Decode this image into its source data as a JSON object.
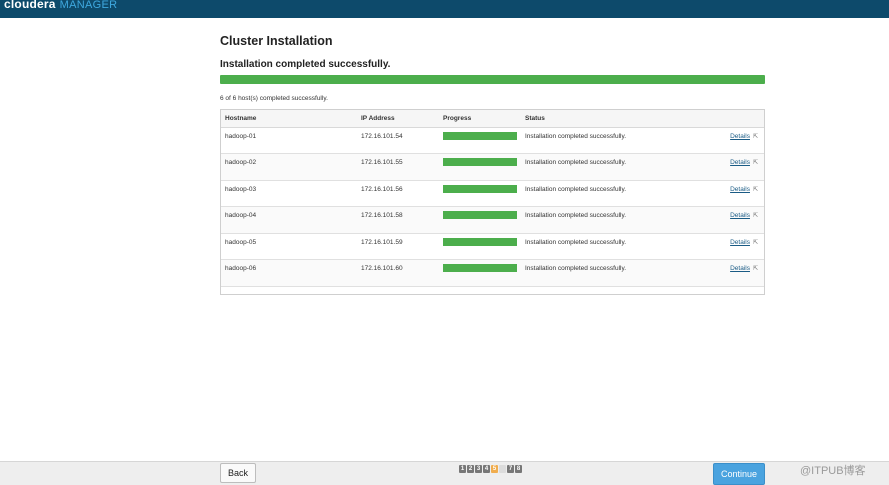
{
  "brand": {
    "name": "cloudera",
    "product": "MANAGER"
  },
  "page": {
    "title": "Cluster Installation",
    "section_title": "Installation completed successfully.",
    "overall_progress_percent": 100,
    "host_summary": "6 of 6 host(s) completed successfully."
  },
  "table": {
    "headers": {
      "hostname": "Hostname",
      "ip": "IP Address",
      "progress": "Progress",
      "status": "Status"
    },
    "rows": [
      {
        "hostname": "hadoop-01",
        "ip": "172.16.101.54",
        "progress_percent": 100,
        "status": "Installation completed successfully.",
        "details": "Details"
      },
      {
        "hostname": "hadoop-02",
        "ip": "172.16.101.55",
        "progress_percent": 100,
        "status": "Installation completed successfully.",
        "details": "Details"
      },
      {
        "hostname": "hadoop-03",
        "ip": "172.16.101.56",
        "progress_percent": 100,
        "status": "Installation completed successfully.",
        "details": "Details"
      },
      {
        "hostname": "hadoop-04",
        "ip": "172.16.101.58",
        "progress_percent": 100,
        "status": "Installation completed successfully.",
        "details": "Details"
      },
      {
        "hostname": "hadoop-05",
        "ip": "172.16.101.59",
        "progress_percent": 100,
        "status": "Installation completed successfully.",
        "details": "Details"
      },
      {
        "hostname": "hadoop-06",
        "ip": "172.16.101.60",
        "progress_percent": 100,
        "status": "Installation completed successfully.",
        "details": "Details"
      }
    ]
  },
  "icons": {
    "details_link": "external-link-icon"
  },
  "footer": {
    "back_label": "Back",
    "continue_label": "Continue",
    "steps": [
      "1",
      "2",
      "3",
      "4",
      "5",
      "6",
      "7",
      "8"
    ],
    "current_step": 5,
    "pending_steps": [
      6
    ],
    "watermark": "@ITPUB博客"
  },
  "colors": {
    "header": "#0d4a6b",
    "brand_accent": "#3fa9e0",
    "progress": "#4cae4c",
    "continue_button": "#4aa3df",
    "current_step": "#f0ad4e"
  }
}
